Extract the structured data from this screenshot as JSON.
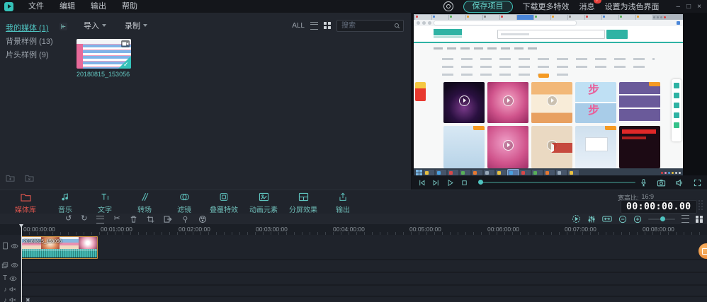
{
  "colors": {
    "accent": "#4fc3c0",
    "active_red": "#e0564e",
    "badge_red": "#e8413c",
    "clip_border": "#c89040",
    "site_teal": "#2fb3a4",
    "fab_orange": "#e87820"
  },
  "titlebar": {
    "menus": [
      "文件",
      "编辑",
      "输出",
      "帮助"
    ],
    "save_button": "保存项目",
    "download_more": "下载更多特效",
    "messages": "消息",
    "messages_badge": "7",
    "theme_toggle": "设置为浅色界面",
    "window_controls": {
      "minimize": "–",
      "maximize": "□",
      "close": "×"
    }
  },
  "media_panel": {
    "categories": [
      {
        "label": "我的媒体 (1)",
        "active": true
      },
      {
        "label": "背景样例 (13)",
        "active": false
      },
      {
        "label": "片头样例 (9)",
        "active": false
      }
    ],
    "import_label": "导入",
    "record_label": "录制",
    "filter_all": "ALL",
    "search_placeholder": "搜索",
    "item_name": "20180815_153056"
  },
  "preview": {
    "tile_glyph": "步"
  },
  "toolbar": {
    "items": [
      {
        "label": "媒体库",
        "active": true
      },
      {
        "label": "音乐",
        "active": false
      },
      {
        "label": "文字",
        "active": false
      },
      {
        "label": "转场",
        "active": false
      },
      {
        "label": "滤镜",
        "active": false
      },
      {
        "label": "叠覆特效",
        "active": false
      },
      {
        "label": "动画元素",
        "active": false
      },
      {
        "label": "分屏效果",
        "active": false
      },
      {
        "label": "输出",
        "active": false
      }
    ]
  },
  "status": {
    "aspect_label": "宽高比:",
    "aspect_value": "16:9",
    "timecode": "00:00:00.00"
  },
  "ruler": {
    "labels": [
      "00:00:00:00",
      "00:01:00:00",
      "00:02:00:00",
      "00:03:00:00",
      "00:04:00:00",
      "00:05:00:00",
      "00:06:00:00",
      "00:07:00:00",
      "00:08:00:00"
    ]
  },
  "timeline": {
    "clip_name": "20180815_153056"
  }
}
